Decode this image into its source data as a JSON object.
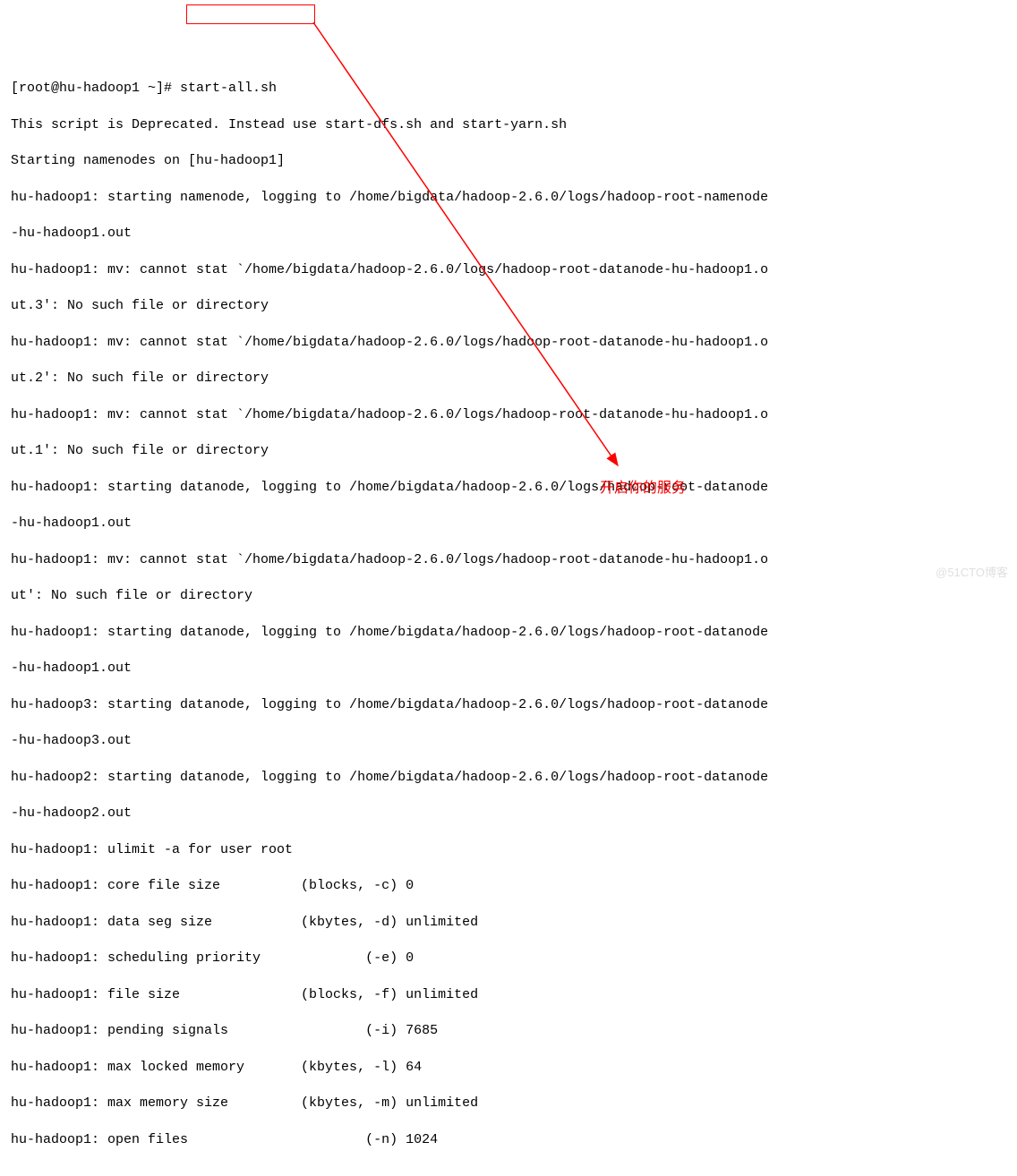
{
  "prompt": "[root@hu-hadoop1 ~]# ",
  "command": "start-all.sh",
  "lines": [
    "This script is Deprecated. Instead use start-dfs.sh and start-yarn.sh",
    "Starting namenodes on [hu-hadoop1]",
    "hu-hadoop1: starting namenode, logging to /home/bigdata/hadoop-2.6.0/logs/hadoop-root-namenode",
    "-hu-hadoop1.out",
    "hu-hadoop1: mv: cannot stat `/home/bigdata/hadoop-2.6.0/logs/hadoop-root-datanode-hu-hadoop1.o",
    "ut.3': No such file or directory",
    "hu-hadoop1: mv: cannot stat `/home/bigdata/hadoop-2.6.0/logs/hadoop-root-datanode-hu-hadoop1.o",
    "ut.2': No such file or directory",
    "hu-hadoop1: mv: cannot stat `/home/bigdata/hadoop-2.6.0/logs/hadoop-root-datanode-hu-hadoop1.o",
    "ut.1': No such file or directory",
    "hu-hadoop1: starting datanode, logging to /home/bigdata/hadoop-2.6.0/logs/hadoop-root-datanode",
    "-hu-hadoop1.out",
    "hu-hadoop1: mv: cannot stat `/home/bigdata/hadoop-2.6.0/logs/hadoop-root-datanode-hu-hadoop1.o",
    "ut': No such file or directory",
    "hu-hadoop1: starting datanode, logging to /home/bigdata/hadoop-2.6.0/logs/hadoop-root-datanode",
    "-hu-hadoop1.out",
    "hu-hadoop3: starting datanode, logging to /home/bigdata/hadoop-2.6.0/logs/hadoop-root-datanode",
    "-hu-hadoop3.out",
    "hu-hadoop2: starting datanode, logging to /home/bigdata/hadoop-2.6.0/logs/hadoop-root-datanode",
    "-hu-hadoop2.out",
    "hu-hadoop1: ulimit -a for user root",
    "hu-hadoop1: core file size          (blocks, -c) 0",
    "hu-hadoop1: data seg size           (kbytes, -d) unlimited",
    "hu-hadoop1: scheduling priority             (-e) 0",
    "hu-hadoop1: file size               (blocks, -f) unlimited",
    "hu-hadoop1: pending signals                 (-i) 7685",
    "hu-hadoop1: max locked memory       (kbytes, -l) 64",
    "hu-hadoop1: max memory size         (kbytes, -m) unlimited",
    "hu-hadoop1: open files                      (-n) 1024"
  ],
  "annotation": "开启你的服务",
  "watermark": "@51CTO博客"
}
